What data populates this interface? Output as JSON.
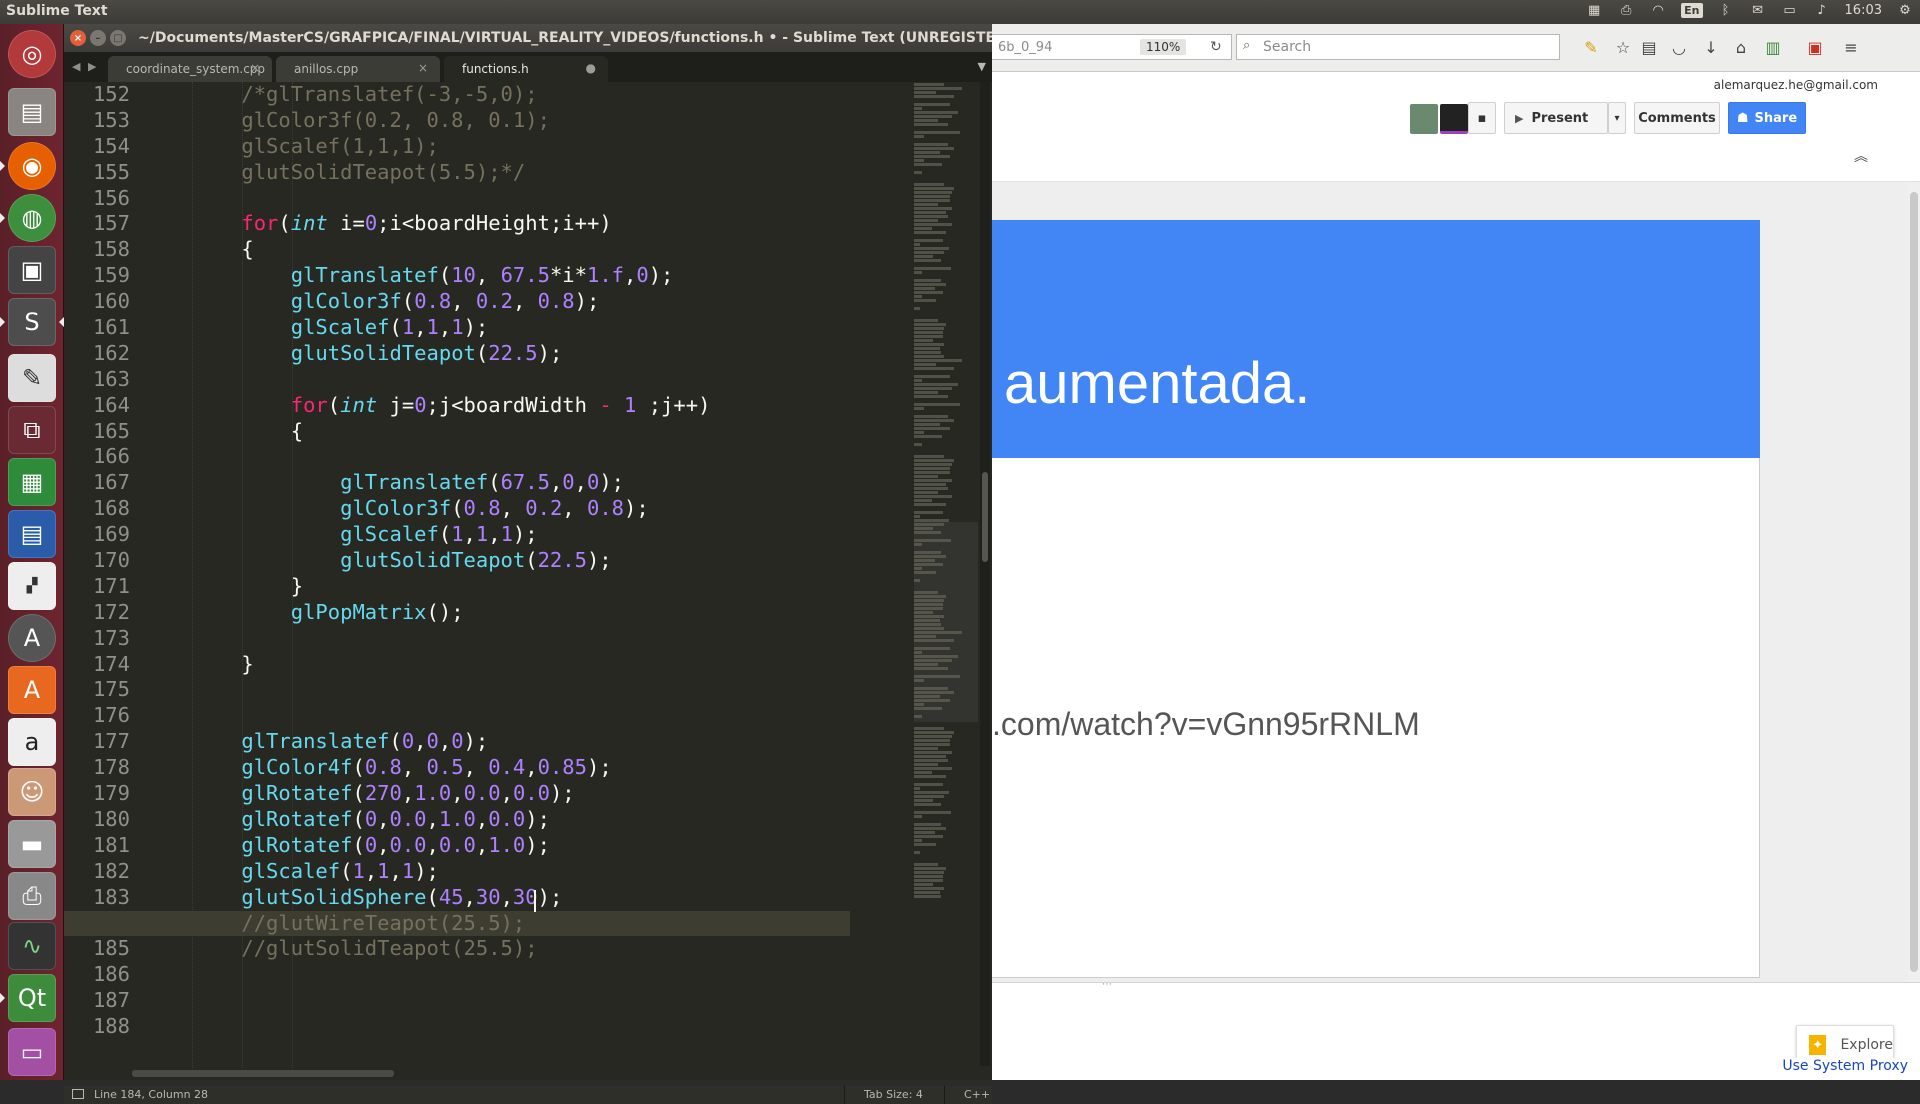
{
  "top_panel": {
    "app_title": "Sublime Text",
    "keyboard_lang": "En",
    "clock": "16:03"
  },
  "sublime": {
    "window_title": "~/Documents/MasterCS/GRAFPICA/FINAL/VIRTUAL_REALITY_VIDEOS/functions.h • - Sublime Text (UNREGISTERED)",
    "tabs": [
      {
        "label": "coordinate_system.cpp",
        "close": "×"
      },
      {
        "label": "anillos.cpp",
        "close": "×"
      },
      {
        "label": "functions.h",
        "close": "●"
      }
    ],
    "status": {
      "position": "Line 184, Column 28",
      "tab_size": "Tab Size: 4",
      "syntax": "C++"
    },
    "code_lines": [
      {
        "n": "152",
        "text": "    /*glTranslatef(-3,-5,0);"
      },
      {
        "n": "153",
        "text": "    glColor3f(0.2, 0.8, 0.1);"
      },
      {
        "n": "154",
        "text": "    glScalef(1,1,1);"
      },
      {
        "n": "155",
        "text": "    glutSolidTeapot(5.5);*/"
      },
      {
        "n": "156",
        "text": ""
      },
      {
        "n": "157",
        "text": "    for(int i=0;i<boardHeight;i++)"
      },
      {
        "n": "158",
        "text": "    {"
      },
      {
        "n": "159",
        "text": "        glTranslatef(10, 67.5*i*1.f,0);"
      },
      {
        "n": "160",
        "text": "        glColor3f(0.8, 0.2, 0.8);"
      },
      {
        "n": "161",
        "text": "        glScalef(1,1,1);"
      },
      {
        "n": "162",
        "text": "        glutSolidTeapot(22.5);"
      },
      {
        "n": "163",
        "text": ""
      },
      {
        "n": "164",
        "text": "        for(int j=0;j<boardWidth - 1 ;j++)"
      },
      {
        "n": "165",
        "text": "        {"
      },
      {
        "n": "166",
        "text": ""
      },
      {
        "n": "167",
        "text": "            glTranslatef(67.5,0,0);"
      },
      {
        "n": "168",
        "text": "            glColor3f(0.8, 0.2, 0.8);"
      },
      {
        "n": "169",
        "text": "            glScalef(1,1,1);"
      },
      {
        "n": "170",
        "text": "            glutSolidTeapot(22.5);"
      },
      {
        "n": "171",
        "text": "        }"
      },
      {
        "n": "172",
        "text": "        glPopMatrix();"
      },
      {
        "n": "173",
        "text": ""
      },
      {
        "n": "174",
        "text": "    }"
      },
      {
        "n": "175",
        "text": ""
      },
      {
        "n": "176",
        "text": ""
      },
      {
        "n": "177",
        "text": "    glTranslatef(0,0,0);"
      },
      {
        "n": "178",
        "text": "    glColor4f(0.8, 0.5, 0.4,0.85);"
      },
      {
        "n": "179",
        "text": "    glRotatef(270,1.0,0.0,0.0);"
      },
      {
        "n": "180",
        "text": "    glRotatef(0,0.0,1.0,0.0);"
      },
      {
        "n": "181",
        "text": "    glRotatef(0,0.0,0.0,1.0);"
      },
      {
        "n": "182",
        "text": "    glScalef(1,1,1);"
      },
      {
        "n": "183",
        "text": "    glutSolidSphere(45,30,30);"
      },
      {
        "n": "184",
        "text": "    //glutWireTeapot(25.5);",
        "current": true
      },
      {
        "n": "185",
        "text": "    //glutSolidTeapot(25.5);"
      },
      {
        "n": "186",
        "text": ""
      },
      {
        "n": "187",
        "text": ""
      },
      {
        "n": "188",
        "text": ""
      }
    ]
  },
  "browser": {
    "url_fragment": "6b_0_94",
    "zoom": "110%",
    "search_placeholder": "Search",
    "account_email": "alemarquez.he@gmail.com",
    "buttons": {
      "present": "Present",
      "comments": "Comments",
      "share": "Share"
    },
    "slide": {
      "title": "aumentada.",
      "link": ".com/watch?v=vGnn95rRNLM"
    },
    "explore_label": "Explore",
    "proxy_label": "Use System Proxy"
  },
  "colors": {
    "editor_bg": "#272822",
    "keyword": "#f92672",
    "function": "#66d9ef",
    "number": "#ae81ff",
    "comment": "#75715e",
    "slide_banner": "#4285f4"
  }
}
